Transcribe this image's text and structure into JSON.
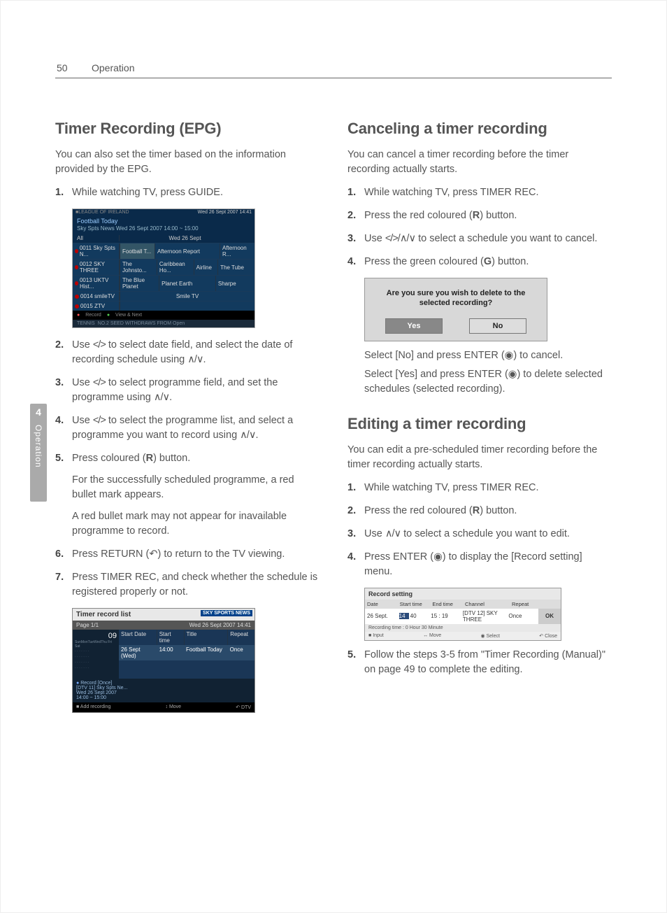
{
  "header": {
    "page_number": "50",
    "section": "Operation"
  },
  "side_tab": {
    "chapter": "4",
    "label": "Operation"
  },
  "left": {
    "h_epg": "Timer Recording (EPG)",
    "lead_epg": "You can also set the timer based on the information provided by the EPG.",
    "steps_epg": {
      "s1": "While watching TV, press GUIDE.",
      "s2a": "Use ",
      "s2b": " to select date field, and select the date of recording schedule using ",
      "s2c": ".",
      "s3a": "Use ",
      "s3b": " to select programme field, and set the programme using ",
      "s3c": ".",
      "s4a": "Use ",
      "s4b": " to select the programme list, and select a programme you want to record using ",
      "s4c": ".",
      "s5a": "Press coloured (",
      "s5b": ") button.",
      "s5_sub1": "For the successfully scheduled programme, a red bullet mark appears.",
      "s5_sub2": "A red bullet mark may not appear for inavailable programme to record.",
      "s6a": "Press RETURN (",
      "s6b": ") to return to the TV viewing.",
      "s7": "Press TIMER REC, and check whether the schedule is registered properly or not."
    },
    "glyph_lr": "</>",
    "glyph_ud": "∧/∨",
    "glyph_lrud": "</>/∧/∨",
    "glyph_R": "R",
    "glyph_return": "↶"
  },
  "right": {
    "h_cancel": "Canceling a timer recording",
    "lead_cancel": "You can cancel a timer recording before the timer recording actually starts.",
    "steps_cancel": {
      "s1": "While watching TV, press TIMER REC.",
      "s2a": "Press the red coloured (",
      "s2b": ") button.",
      "s3a": "Use ",
      "s3b": " to select a schedule you want to cancel.",
      "s4a": "Press the green coloured (",
      "s4b": ") button."
    },
    "glyph_G": "G",
    "after_cancel1a": "Select [No] and press ENTER (",
    "after_cancel1b": ") to cancel.",
    "after_cancel2a": "Select [Yes] and press ENTER (",
    "after_cancel2b": ") to delete selected schedules (selected recording).",
    "glyph_enter": "◉",
    "h_edit": "Editing a timer recording",
    "lead_edit": "You can edit a pre-scheduled timer recording before the timer recording actually starts.",
    "steps_edit": {
      "s1": "While watching TV, press TIMER REC.",
      "s2a": "Press the red coloured (",
      "s2b": ") button.",
      "s3a": "Use ",
      "s3b": " to select a schedule you want to edit.",
      "s4a": "Press ENTER (",
      "s4b": ") to display the [Record setting] menu.",
      "s5": "Follow the steps 3-5 from \"Timer Recording (Manual)\" on page 49 to complete the editing."
    }
  },
  "epg": {
    "title": "Football Today",
    "sub": "Sky Spts News  Wed 26 Sept 2007  14:00 ~ 15:00",
    "right_time": "Wed 26 Sept 2007 14:41",
    "day": "Wed 26 Sept",
    "all": "All",
    "rows": [
      {
        "ch": "0011 Sky Spts N...",
        "c1": "Football T...",
        "c2": "Afternoon Report",
        "c3": "Afternoon R..."
      },
      {
        "ch": "0012 SKY THREE",
        "c1": "The Johnsto...",
        "c2": "Caribbean Ho...",
        "c3": "Airline",
        "c4": "The Tube"
      },
      {
        "ch": "0013 UKTV Hist...",
        "c1": "The Blue Planet",
        "c2": "Planet Earth",
        "c3": "Sharpe"
      },
      {
        "ch": "0014 smileTV",
        "c2": "Smile TV"
      },
      {
        "ch": "0015 ZTV"
      }
    ],
    "foot1": "Record",
    "foot2": "View & Next",
    "tennis": "TENNIS",
    "news": "NO.2 SEED WITHDRAWS FROM Open"
  },
  "trl": {
    "title": "Timer record list",
    "tag": "SKY SPORTS NEWS",
    "page": "Page 1/1",
    "date": "Wed 26 Sept 2007 14:41",
    "cols": [
      "Start Date",
      "Start time",
      "Title",
      "Repeat"
    ],
    "row": {
      "date": "26 Sept (Wed)",
      "time": "14:00",
      "title": "Football Today",
      "repeat": "Once"
    },
    "side_month": "09",
    "side_days": "SunMonTueWedThu Fri Sat",
    "rec_label": "Record [Once]",
    "rec_ch": "[DTV 11] Sky Spts Ne...",
    "rec_when": "Wed 26 Sept 2007",
    "rec_time": "14:00 ~ 15:00",
    "bot_left": "Add recording",
    "bot_mid": "Move",
    "bot_right": "DTV"
  },
  "confirm": {
    "q1": "Are you sure you wish to delete to the",
    "q2": "selected recording?",
    "yes": "Yes",
    "no": "No"
  },
  "rset": {
    "title": "Record setting",
    "cols": [
      "Date",
      "Start time",
      "End time",
      "Channel",
      "Repeat",
      ""
    ],
    "row": {
      "date": "26 Sept.",
      "st_h": "14",
      "st_m": "40",
      "et": "15 : 19",
      "ch": "[DTV 12] SKY THREE",
      "rep": "Once",
      "ok": "OK"
    },
    "info": "Recording time : 0 Hour  30 Minute",
    "bot": [
      "Input",
      "Move",
      "Select",
      "Close"
    ]
  }
}
